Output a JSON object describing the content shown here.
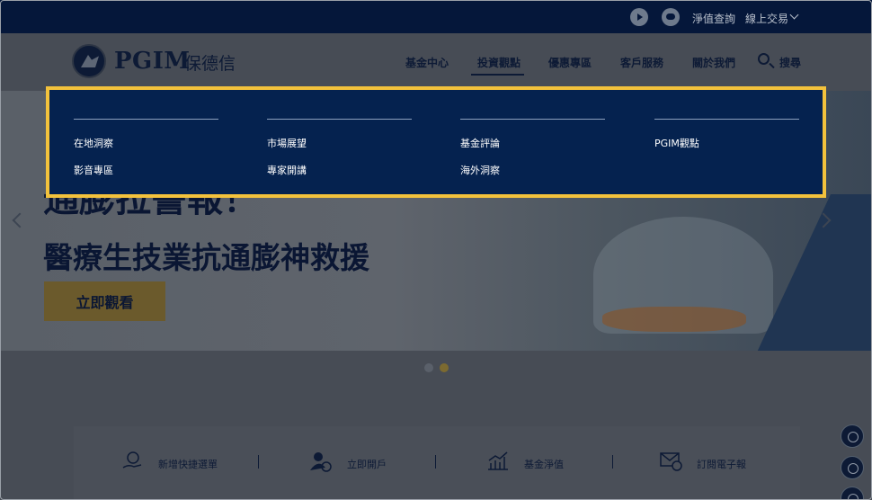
{
  "topbar": {
    "icons": [
      "youtube-icon",
      "line-icon"
    ],
    "nav_query": "淨值查詢",
    "online_trade": "線上交易"
  },
  "header": {
    "logo_text": "PGIM",
    "logo_cn": "保德信",
    "nav": [
      "基金中心",
      "投資觀點",
      "優惠專區",
      "客戶服務",
      "關於我們",
      "搜尋"
    ]
  },
  "mega_menu": {
    "items": [
      "在地洞察",
      "影音專區",
      "市場展望",
      "專家開講",
      "基金評論",
      "海外洞察",
      "PGIM觀點"
    ]
  },
  "hero": {
    "title_line1": "通膨拉警報！",
    "title_line2": "醫療生技業抗通膨神救援",
    "cta": "立即觀看"
  },
  "quick_links": [
    "新增快捷選單",
    "立即開戶",
    "基金淨值",
    "訂閱電子報"
  ],
  "colors": {
    "menu_bg": "#05224f",
    "menu_border": "#f3c23c",
    "topbar_bg": "#05173a"
  }
}
